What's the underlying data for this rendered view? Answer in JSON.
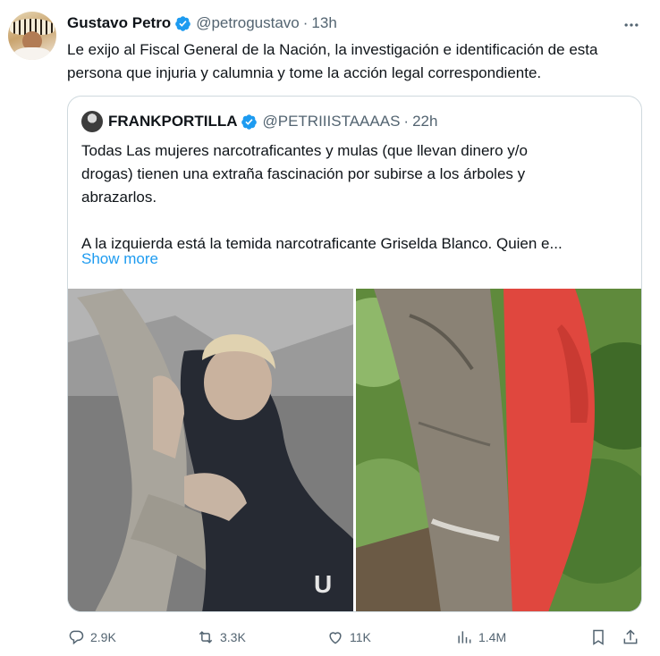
{
  "author": {
    "display_name": "Gustavo Petro",
    "handle": "@petrogustavo",
    "separator": "·",
    "time": "13h"
  },
  "tweet_text": "Le exijo al Fiscal General de la Nación, la investigación e identificación de esta persona que injuria y calumnia y tome la acción legal correspondiente.",
  "quoted_tweet": {
    "display_name": "FRANKPORTILLA",
    "handle": "@PETRIIISTAAAAS",
    "separator": "·",
    "time": "22h",
    "text_lines": [
      "Todas Las mujeres narcotraficantes y mulas (que llevan dinero y/o",
      "drogas)  tienen una extraña fascinación  por subirse a los árboles y",
      "abrazarlos.",
      "A la izquierda está la temida narcotraficante  Griselda Blanco. Quien e..."
    ],
    "show_more": "Show more",
    "media_watermark": "U"
  },
  "actions": {
    "replies": "2.9K",
    "reposts": "3.3K",
    "likes": "11K",
    "views": "1.4M"
  },
  "colors": {
    "text": "#0f1419",
    "secondary": "#536471",
    "accent": "#1d9bf0",
    "border": "#cfd9de",
    "verified": "#1d9bf0"
  },
  "icons": [
    "verified-badge-icon",
    "more-options-icon",
    "reply-icon",
    "repost-icon",
    "like-icon",
    "views-icon",
    "bookmark-icon",
    "share-icon"
  ]
}
